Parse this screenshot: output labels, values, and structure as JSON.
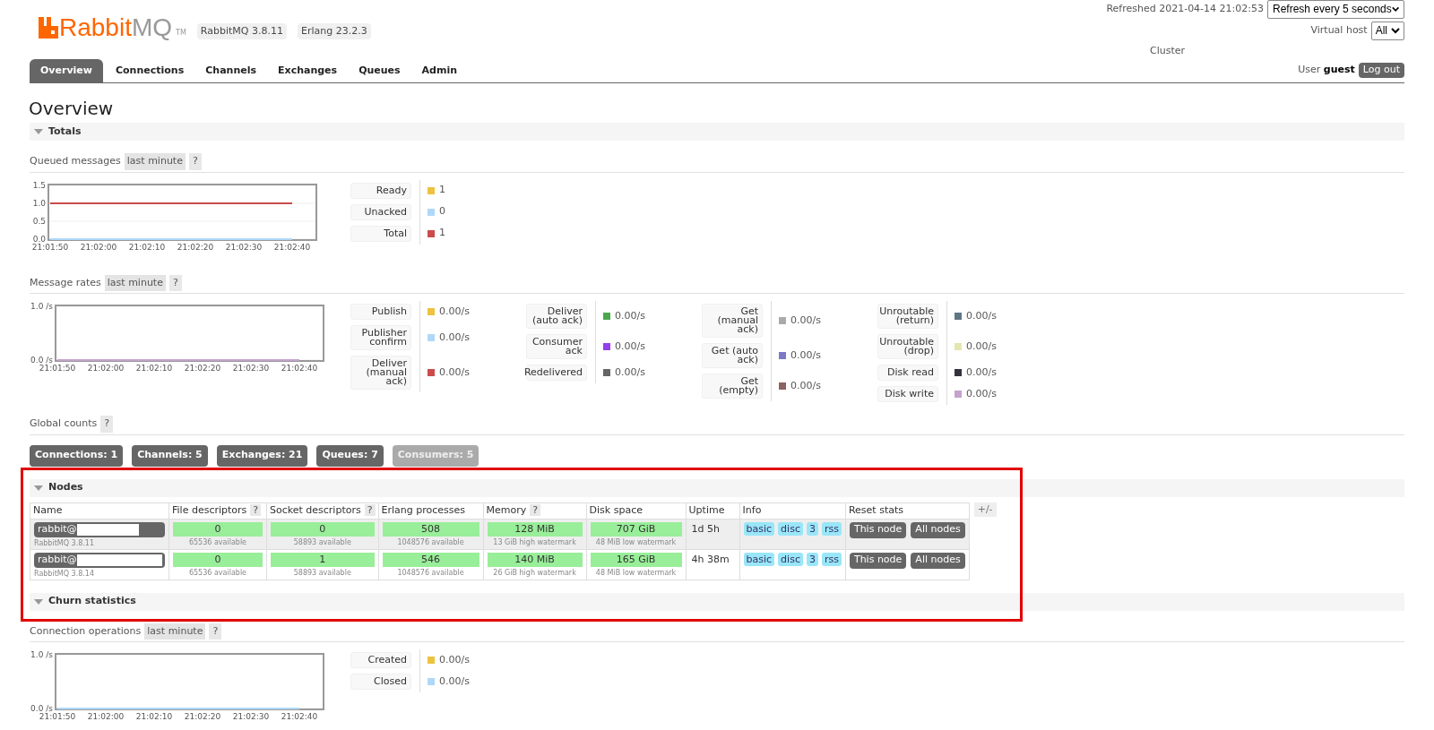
{
  "header": {
    "logo": {
      "name": "Rabbit",
      "suffix": "MQ",
      "mark": "TM"
    },
    "versions": [
      "RabbitMQ 3.8.11",
      "Erlang 23.2.3"
    ],
    "refreshed": "Refreshed 2021-04-14 21:02:53",
    "refresh_select": "Refresh every 5 seconds",
    "vhost_label": "Virtual host",
    "vhost_select": "All",
    "cluster": "Cluster",
    "user_label": "User",
    "user": "guest",
    "logout": "Log out"
  },
  "tabs": [
    {
      "label": "Overview",
      "selected": true
    },
    {
      "label": "Connections",
      "selected": false
    },
    {
      "label": "Channels",
      "selected": false
    },
    {
      "label": "Exchanges",
      "selected": false
    },
    {
      "label": "Queues",
      "selected": false
    },
    {
      "label": "Admin",
      "selected": false
    }
  ],
  "title": "Overview",
  "sections": [
    {
      "title": "Totals",
      "expanded": true,
      "panels": [
        {
          "kind": "chart",
          "title": "Queued messages",
          "range": "last minute",
          "help": "?",
          "chart_data": {
            "type": "line",
            "categories": [
              "21:01:50",
              "21:02:00",
              "21:02:10",
              "21:02:20",
              "21:02:30",
              "21:02:40"
            ],
            "ylim": [
              0,
              1.5
            ],
            "yticks": [
              {
                "value": 0,
                "label": "0.0"
              },
              {
                "value": 0.5,
                "label": "0.5"
              },
              {
                "value": 1,
                "label": "1.0"
              },
              {
                "value": 1.5,
                "label": "1.5"
              }
            ],
            "series": [
              {
                "name": "Ready",
                "color": "#edc240",
                "values": [
                  null,
                  null,
                  null,
                  null,
                  null,
                  null
                ]
              },
              {
                "name": "Unacked",
                "color": "#afd8f8",
                "values": [
                  0,
                  0,
                  0,
                  0,
                  0,
                  0
                ]
              },
              {
                "name": "Total",
                "color": "#cb4b4b",
                "values": [
                  1,
                  1,
                  1,
                  1,
                  1,
                  1
                ]
              }
            ]
          },
          "legend": [
            {
              "value": "1"
            },
            {
              "value": "0"
            },
            {
              "value": "1"
            }
          ]
        },
        {
          "kind": "chart",
          "title": "Message rates",
          "range": "last minute",
          "help": "?",
          "chart_data": {
            "type": "line",
            "categories": [
              "21:01:50",
              "21:02:00",
              "21:02:10",
              "21:02:20",
              "21:02:30",
              "21:02:40"
            ],
            "ylim": [
              0,
              1
            ],
            "yticks": [
              {
                "value": 0,
                "label": "0.0 /s"
              },
              {
                "value": 1,
                "label": "1.0 /s"
              }
            ],
            "series": [
              {
                "name": "Publish",
                "color": "#edc240",
                "values": [
                  null,
                  null,
                  null,
                  null,
                  null,
                  null
                ]
              },
              {
                "name": "Publisher confirm",
                "color": "#afd8f8",
                "values": [
                  null,
                  null,
                  null,
                  null,
                  null,
                  null
                ]
              },
              {
                "name": "Deliver (manual ack)",
                "color": "#cb4b4b",
                "values": [
                  null,
                  null,
                  null,
                  null,
                  null,
                  null
                ]
              },
              {
                "name": "Deliver (auto ack)",
                "color": "#4da74d",
                "values": [
                  null,
                  null,
                  null,
                  null,
                  null,
                  null
                ]
              },
              {
                "name": "Consumer ack",
                "color": "#9440ed",
                "values": [
                  null,
                  null,
                  null,
                  null,
                  null,
                  null
                ]
              },
              {
                "name": "Redelivered",
                "color": "#666666",
                "values": [
                  null,
                  null,
                  null,
                  null,
                  null,
                  null
                ]
              },
              {
                "name": "Get (manual ack)",
                "color": "#aaaaaa",
                "values": [
                  null,
                  null,
                  null,
                  null,
                  null,
                  null
                ]
              },
              {
                "name": "Get (auto ack)",
                "color": "#7c79c9",
                "values": [
                  null,
                  null,
                  null,
                  null,
                  null,
                  null
                ]
              },
              {
                "name": "Get (empty)",
                "color": "#8d6262",
                "values": [
                  null,
                  null,
                  null,
                  null,
                  null,
                  null
                ]
              },
              {
                "name": "Unroutable (return)",
                "color": "#5f7685",
                "values": [
                  null,
                  null,
                  null,
                  null,
                  null,
                  null
                ]
              },
              {
                "name": "Unroutable (drop)",
                "color": "#e5e5b0",
                "values": [
                  null,
                  null,
                  null,
                  null,
                  null,
                  null
                ]
              },
              {
                "name": "Disk read",
                "color": "#33333f",
                "values": [
                  null,
                  null,
                  null,
                  null,
                  null,
                  null
                ]
              },
              {
                "name": "Disk write",
                "color": "#c3a3cc",
                "values": [
                  0,
                  0,
                  0,
                  0,
                  0,
                  0
                ]
              }
            ]
          },
          "legend": [
            {
              "value": "0.00/s"
            },
            {
              "value": "0.00/s"
            },
            {
              "value": "0.00/s"
            },
            {
              "value": "0.00/s",
              "column_start": true
            },
            {
              "value": "0.00/s"
            },
            {
              "value": "0.00/s"
            },
            {
              "value": "0.00/s",
              "column_start": true
            },
            {
              "value": "0.00/s"
            },
            {
              "value": "0.00/s"
            },
            {
              "value": "0.00/s",
              "column_start": true
            },
            {
              "value": "0.00/s"
            },
            {
              "value": "0.00/s"
            },
            {
              "value": "0.00/s"
            }
          ]
        },
        {
          "kind": "counts",
          "title": "Global counts",
          "help": "?",
          "buttons": [
            {
              "label": "Connections: 1",
              "disabled": false
            },
            {
              "label": "Channels: 5",
              "disabled": false
            },
            {
              "label": "Exchanges: 21",
              "disabled": false
            },
            {
              "label": "Queues: 7",
              "disabled": false
            },
            {
              "label": "Consumers: 5",
              "disabled": true
            }
          ]
        }
      ]
    },
    {
      "title": "Nodes",
      "expanded": true,
      "panels": [
        {
          "kind": "table",
          "toggle": "+/-",
          "columns": [
            {
              "label": "Name"
            },
            {
              "label": "File descriptors",
              "help": "?"
            },
            {
              "label": "Socket descriptors",
              "help": "?"
            },
            {
              "label": "Erlang processes"
            },
            {
              "label": "Memory",
              "help": "?"
            },
            {
              "label": "Disk space"
            },
            {
              "label": "Uptime"
            },
            {
              "label": "Info"
            },
            {
              "label": "Reset stats"
            }
          ],
          "rows": [
            {
              "cells": [
                {
                  "kind": "node",
                  "value": "rabbit@",
                  "note": "RabbitMQ 3.8.11"
                },
                {
                  "kind": "meter",
                  "value": "0",
                  "note": "65536 available"
                },
                {
                  "kind": "meter",
                  "value": "0",
                  "note": "58893 available"
                },
                {
                  "kind": "meter",
                  "value": "508",
                  "note": "1048576 available"
                },
                {
                  "kind": "meter",
                  "value": "128 MiB",
                  "note": "13 GiB high watermark"
                },
                {
                  "kind": "meter",
                  "value": "707 GiB",
                  "note": "48 MiB low watermark"
                },
                {
                  "kind": "text",
                  "value": "1d 5h"
                },
                {
                  "kind": "tags",
                  "tags": [
                    "basic",
                    "disc",
                    "3",
                    "rss"
                  ]
                },
                {
                  "kind": "buttons",
                  "buttons": [
                    "This node",
                    "All nodes"
                  ]
                }
              ]
            },
            {
              "cells": [
                {
                  "kind": "node",
                  "value": "rabbit@",
                  "note": "RabbitMQ 3.8.14"
                },
                {
                  "kind": "meter",
                  "value": "0",
                  "note": "65536 available"
                },
                {
                  "kind": "meter",
                  "value": "1",
                  "note": "58893 available"
                },
                {
                  "kind": "meter",
                  "value": "546",
                  "note": "1048576 available"
                },
                {
                  "kind": "meter",
                  "value": "140 MiB",
                  "note": "26 GiB high watermark"
                },
                {
                  "kind": "meter",
                  "value": "165 GiB",
                  "note": "48 MiB low watermark"
                },
                {
                  "kind": "text",
                  "value": "4h 38m"
                },
                {
                  "kind": "tags",
                  "tags": [
                    "basic",
                    "disc",
                    "3",
                    "rss"
                  ]
                },
                {
                  "kind": "buttons",
                  "buttons": [
                    "This node",
                    "All nodes"
                  ]
                }
              ]
            }
          ]
        }
      ]
    },
    {
      "title": "Churn statistics",
      "expanded": true,
      "panels": [
        {
          "kind": "chart",
          "title": "Connection operations",
          "range": "last minute",
          "help": "?",
          "chart_data": {
            "type": "line",
            "categories": [
              "21:01:50",
              "21:02:00",
              "21:02:10",
              "21:02:20",
              "21:02:30",
              "21:02:40"
            ],
            "ylim": [
              0,
              1
            ],
            "yticks": [
              {
                "value": 0,
                "label": "0.0 /s"
              },
              {
                "value": 1,
                "label": "1.0 /s"
              }
            ],
            "series": [
              {
                "name": "Created",
                "color": "#edc240",
                "values": [
                  null,
                  null,
                  null,
                  null,
                  null,
                  null
                ]
              },
              {
                "name": "Closed",
                "color": "#afd8f8",
                "values": [
                  0,
                  0,
                  0,
                  0,
                  0,
                  0
                ]
              }
            ]
          },
          "legend": [
            {
              "value": "0.00/s"
            },
            {
              "value": "0.00/s"
            }
          ]
        }
      ]
    }
  ]
}
